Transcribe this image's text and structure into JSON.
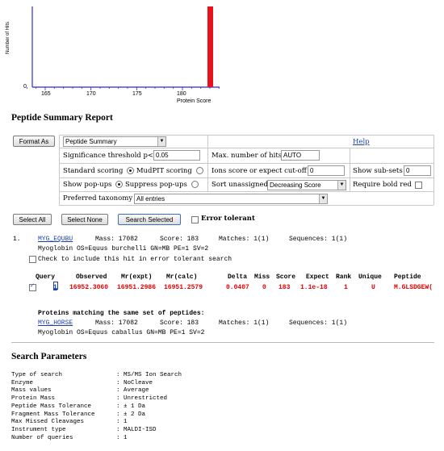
{
  "histogram": {
    "ylabel": "Number of Hits",
    "y_zero": "0",
    "xlabel": "Protein Score",
    "ticks": [
      "165",
      "170",
      "175",
      "180"
    ]
  },
  "chart_data": {
    "type": "bar",
    "xlabel": "Protein Score",
    "ylabel": "Number of Hits",
    "x_ticks": [
      165,
      170,
      175,
      180
    ],
    "xlim": [
      163,
      185
    ],
    "bars": [
      {
        "x": 183,
        "value": 1,
        "color": "#e8121b"
      }
    ]
  },
  "summary": {
    "title": "Peptide Summary Report",
    "format_as_button": "Format As",
    "format_select": "Peptide Summary",
    "help_link": "Help",
    "sig_label": "Significance threshold p<",
    "sig_value": "0.05",
    "maxhits_label": "Max. number of hits",
    "maxhits_value": "AUTO",
    "standard_scoring": "Standard scoring",
    "mudpit_scoring": "MudPIT scoring",
    "ions_cutoff_label": "Ions score or expect cut-off",
    "ions_cutoff_value": "0",
    "subsets_label": "Show sub-sets",
    "subsets_value": "0",
    "show_popups": "Show pop-ups",
    "suppress_popups": "Suppress pop-ups",
    "sort_unassigned_label": "Sort unassigned",
    "sort_select": "Decreasing Score",
    "require_bold_red": "Require bold red",
    "taxonomy_label": "Preferred taxonomy",
    "taxonomy_select": "All entries"
  },
  "actions": {
    "select_all": "Select All",
    "select_none": "Select None",
    "search_selected": "Search Selected",
    "error_tolerant": "Error tolerant"
  },
  "hit": {
    "number": "1.",
    "accession": "MYG_EQUBU",
    "mass_text": "Mass: 17082",
    "score_text": "Score: 183",
    "matches_text": "Matches: 1(1)",
    "sequences_text": "Sequences: 1(1)",
    "description": "Myoglobin OS=Equus burchelli GN=MB PE=1 SV=2",
    "check_text": "Check to include this hit in error tolerant search"
  },
  "peptide_table": {
    "headers": [
      "Query",
      "Observed",
      "Mr(expt)",
      "Mr(calc)",
      "Delta",
      "Miss",
      "Score",
      "Expect",
      "Rank",
      "Unique",
      "Peptide"
    ],
    "row": [
      "1",
      "16952.3060",
      "16951.2986",
      "16951.2579",
      "0.0407",
      "0",
      "183",
      "1.1e-18",
      "1",
      "U",
      "M.GLSDGEW("
    ]
  },
  "same_set": {
    "heading": "Proteins matching the same set of peptides:",
    "accession": "MYG_HORSE",
    "mass_text": "Mass: 17082",
    "score_text": "Score: 183",
    "matches_text": "Matches: 1(1)",
    "sequences_text": "Sequences: 1(1)",
    "description": "Myoglobin OS=Equus caballus GN=MB PE=1 SV=2"
  },
  "params": {
    "title": "Search Parameters",
    "rows": [
      {
        "label": "Type of search",
        "value": ": MS/MS Ion Search"
      },
      {
        "label": "Enzyme",
        "value": ": NoCleave"
      },
      {
        "label": "Mass values",
        "value": ": Average"
      },
      {
        "label": "Protein Mass",
        "value": ": Unrestricted"
      },
      {
        "label": "Peptide Mass Tolerance",
        "value": ": ± 1 Da"
      },
      {
        "label": "Fragment Mass Tolerance",
        "value": ": ± 2 Da"
      },
      {
        "label": "Max Missed Cleavages",
        "value": ": 1"
      },
      {
        "label": "Instrument type",
        "value": ": MALDI-ISD"
      },
      {
        "label": "Number of queries",
        "value": ": 1"
      }
    ]
  }
}
